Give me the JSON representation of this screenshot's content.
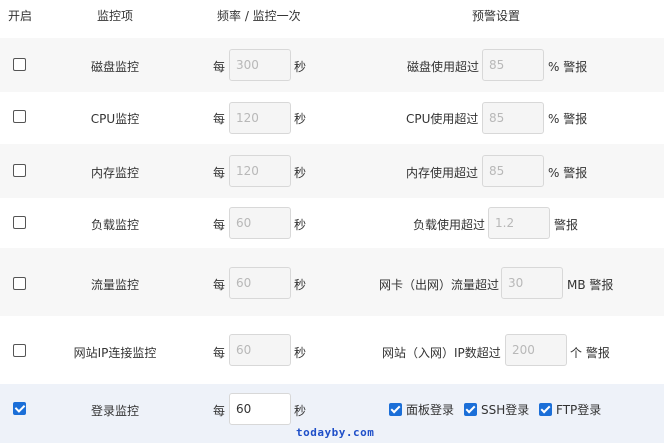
{
  "header": {
    "col_enable": "开启",
    "col_item": "监控项",
    "col_freq": "频率 / 监控一次",
    "col_alert": "预警设置"
  },
  "rows": [
    {
      "enabled": false,
      "name": "磁盘监控",
      "prefix": "每",
      "freq": "300",
      "freq_unit": "秒",
      "alert_label": "磁盘使用超过",
      "alert_value": "85",
      "alert_unit": "% 警报"
    },
    {
      "enabled": false,
      "name": "CPU监控",
      "prefix": "每",
      "freq": "120",
      "freq_unit": "秒",
      "alert_label": "CPU使用超过",
      "alert_value": "85",
      "alert_unit": "% 警报"
    },
    {
      "enabled": false,
      "name": "内存监控",
      "prefix": "每",
      "freq": "120",
      "freq_unit": "秒",
      "alert_label": "内存使用超过",
      "alert_value": "85",
      "alert_unit": "% 警报"
    },
    {
      "enabled": false,
      "name": "负载监控",
      "prefix": "每",
      "freq": "60",
      "freq_unit": "秒",
      "alert_label": "负载使用超过",
      "alert_value": "1.2",
      "alert_unit": "警报"
    },
    {
      "enabled": false,
      "name": "流量监控",
      "prefix": "每",
      "freq": "60",
      "freq_unit": "秒",
      "alert_label": "网卡（出网）流量超过",
      "alert_value": "30",
      "alert_unit": "MB 警报"
    },
    {
      "enabled": false,
      "name": "网站IP连接监控",
      "prefix": "每",
      "freq": "60",
      "freq_unit": "秒",
      "alert_label": "网站（入网）IP数超过",
      "alert_value": "200",
      "alert_unit": "个 警报"
    },
    {
      "enabled": true,
      "name": "登录监控",
      "prefix": "每",
      "freq": "60",
      "freq_unit": "秒",
      "login_options": [
        "面板登录",
        "SSH登录",
        "FTP登录"
      ]
    }
  ],
  "watermark": "todayby.com",
  "colors": {
    "accent": "#1b6fd8",
    "alt_row": "#f7f7f7",
    "selected_row": "#eef2f9"
  }
}
